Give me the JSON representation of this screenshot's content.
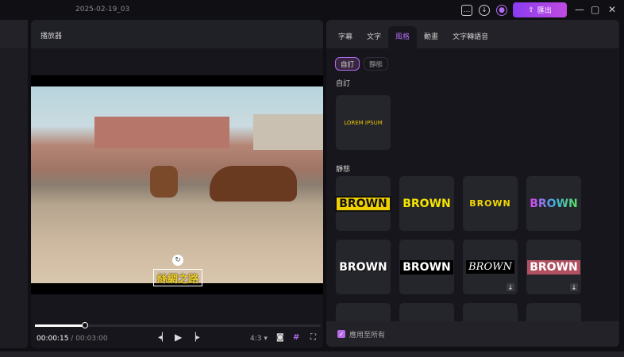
{
  "titlebar": {
    "title": "2025-02-19_03",
    "export_label": "匯出",
    "icons": [
      "feedback-icon",
      "download-icon",
      "account-icon"
    ]
  },
  "player": {
    "title": "播放器",
    "subtitle_text": "絲綢之路",
    "current_time": "00:00:15",
    "total_time": "/ 00:03:00",
    "progress": 0.083,
    "aspect_ratio": "4:3"
  },
  "panel": {
    "tabs": [
      {
        "label": "字幕"
      },
      {
        "label": "文字"
      },
      {
        "label": "風格",
        "active": true
      },
      {
        "label": "動畫"
      },
      {
        "label": "文字轉語音"
      }
    ],
    "filters": [
      {
        "label": "自訂",
        "active": true
      },
      {
        "label": "靜態"
      }
    ],
    "custom_section": "自訂",
    "custom_preview": "LOREM IPSUM",
    "static_section": "靜態",
    "styles": [
      "BROWN",
      "BROWN",
      "BROWN",
      "BROWN",
      "BROWN",
      "BROWN",
      "BROWN",
      "BROWN"
    ],
    "apply_all_label": "應用至所有",
    "apply_all_checked": true
  },
  "colors": {
    "accent": "#b16cf0",
    "export_gradient_start": "#8a3cf0",
    "subtitle": "#f1d02a"
  }
}
